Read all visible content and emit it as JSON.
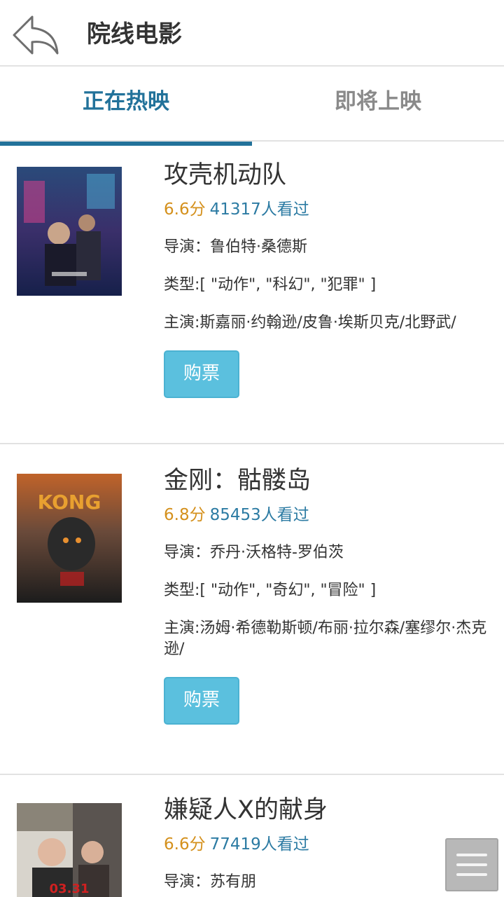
{
  "header": {
    "title": "院线电影",
    "back_icon": "back-arrow-icon"
  },
  "tabs": [
    {
      "label": "正在热映",
      "active": true
    },
    {
      "label": "即将上映",
      "active": false
    }
  ],
  "colors": {
    "accent": "#22729a",
    "score": "#d4901c",
    "viewers": "#2c7ba3",
    "buy_button": "#5bc0de"
  },
  "movies": [
    {
      "title": "攻壳机动队",
      "score": "6.6分",
      "viewers": "41317人看过",
      "director": "导演：鲁伯特·桑德斯",
      "genre": "类型:[ \"动作\", \"科幻\", \"犯罪\" ]",
      "cast": "主演:斯嘉丽·约翰逊/皮鲁·埃斯贝克/北野武/",
      "buy_label": "购票"
    },
    {
      "title": "金刚：骷髅岛",
      "score": "6.8分",
      "viewers": "85453人看过",
      "director": "导演：乔丹·沃格特-罗伯茨",
      "genre": "类型:[ \"动作\", \"奇幻\", \"冒险\" ]",
      "cast": "主演:汤姆·希德勒斯顿/布丽·拉尔森/塞缪尔·杰克逊/",
      "buy_label": "购票",
      "poster_text": "KONG"
    },
    {
      "title": "嫌疑人X的献身",
      "score": "6.6分",
      "viewers": "77419人看过",
      "director": "导演：苏有朋",
      "poster_text": "03.31"
    }
  ],
  "float_menu_icon": "hamburger-menu-icon"
}
